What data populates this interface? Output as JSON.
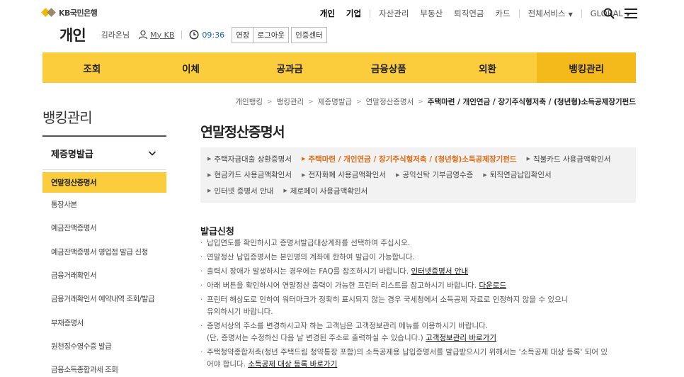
{
  "brand": {
    "logo_text": "KB국민은행"
  },
  "gnb": {
    "personal": "개인",
    "corporate": "기업",
    "asset": "자산관리",
    "realestate": "부동산",
    "pension": "퇴직연금",
    "card": "카드",
    "all_services": "전체서비스",
    "global": "GLOBAL"
  },
  "subhead": {
    "title": "개인",
    "user_name": "김라온님",
    "mykb": "My KB",
    "time": "09:36",
    "extend": "연장",
    "logout": "로그아웃",
    "cert_center": "인증센터"
  },
  "mainnav": [
    "조회",
    "이체",
    "공과금",
    "금융상품",
    "외환",
    "뱅킹관리"
  ],
  "breadcrumb": [
    "개인뱅킹",
    "뱅킹관리",
    "제증명발급",
    "연말정산증명서",
    "주택마련 / 개인연금 / 장기주식형저축 / (청년형)소득공제장기펀드"
  ],
  "sidebar": {
    "title": "뱅킹관리",
    "group": "제증명발급",
    "items": [
      "연말정산증명서",
      "통장사본",
      "예금잔액증명서",
      "예금잔액증명서 영업점 발급 신청",
      "금융거래확인서",
      "금융거래확인서 예약내역 조회/발급",
      "부채증명서",
      "원천징수영수증 발급",
      "금융소득종합과세 조회"
    ]
  },
  "content": {
    "title": "연말정산증명서",
    "tabs": [
      "주택자금대출 상환증명서",
      "주택마련 / 개인연금 / 장기주식형저축 / (청년형)소득공제장기펀드",
      "직불카드 사용금액확인서",
      "현금카드 사용금액확인서",
      "전자화폐 사용금액확인서",
      "공익신탁 기부금영수증",
      "퇴직연금납입확인서",
      "인터넷 증명서 안내",
      "제로페이 사용금액확인서"
    ],
    "section_title": "발급신청",
    "notes": {
      "n1": "납입연도를 확인하시고 증명서발급대상계좌를 선택하여 주십시오.",
      "n2": "연말정산 납입증명서는 본인명의 계좌에 한하여 발급이 가능합니다.",
      "n3": "출력시 장애가 발생하시는 경우에는 FAQ를 참조하시기 바랍니다.",
      "n3_link": "인터넷증명서 안내",
      "n4": "아래 버튼을 확인하시어 연말정산 출력이 가능한 프린터 리스트를 참고하시기 바랍니다.",
      "n4_link": "다운로드",
      "n5a": "프린터 해상도로 인하여 워터마크가 정확히 표시되지 않는 경우 국세청에서 소득공제 자료로 인정하지 않을 수 있으니",
      "n5b": "유의하시기 바랍니다.",
      "n6a": "증명서상의 주소를 변경하시고자 하는 고객님은 고객정보관리 메뉴를 이용하시기 바랍니다.",
      "n6b": "(단, 증명서는 수정하신 다음 날 변경된 주소로 출력하실 수 있습니다.)",
      "n6_link": "고객정보관리 바로가기",
      "n7a": "주택청약종합저축(청년 주택드림 청약통장 포함)의 소득공제용 납입증명서를 발급받으시기 위해서는 '소득공제 대상 등록' 되어 있",
      "n7b": "어야 합니다.",
      "n7_link": "소득공제 대상 등록 바로가기"
    }
  }
}
